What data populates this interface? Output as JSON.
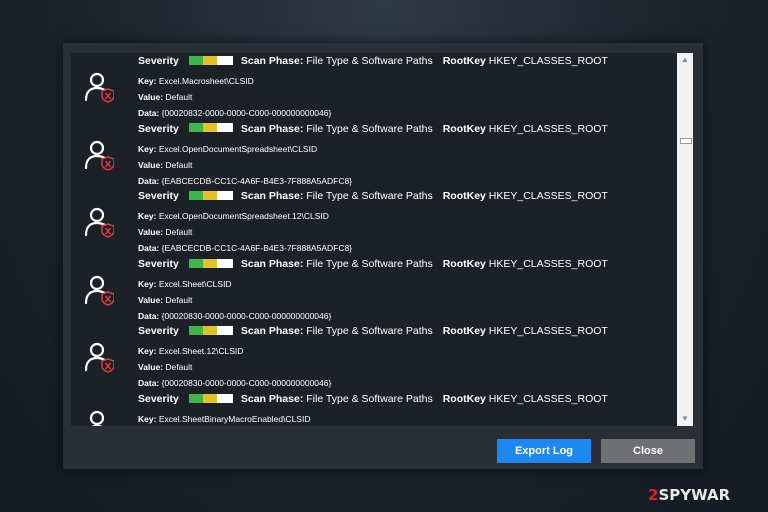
{
  "entries": [
    {
      "severity_label": "Severity",
      "phase_label": "Scan Phase:",
      "phase_value": "File Type & Software Paths",
      "rootkey_label": "RootKey",
      "rootkey_value": "HKEY_CLASSES_ROOT",
      "key_label": "Key:",
      "key_value": "Excel.Macrosheet\\CLSID",
      "value_label": "Value:",
      "value_value": "Default",
      "data_label": "Data:",
      "data_value": "{00020832-0000-0000-C000-000000000046}"
    },
    {
      "severity_label": "Severity",
      "phase_label": "Scan Phase:",
      "phase_value": "File Type & Software Paths",
      "rootkey_label": "RootKey",
      "rootkey_value": "HKEY_CLASSES_ROOT",
      "key_label": "Key:",
      "key_value": "Excel.OpenDocumentSpreadsheet\\CLSID",
      "value_label": "Value:",
      "value_value": "Default",
      "data_label": "Data:",
      "data_value": "{EABCECDB-CC1C-4A6F-B4E3-7F888A5ADFC8}"
    },
    {
      "severity_label": "Severity",
      "phase_label": "Scan Phase:",
      "phase_value": "File Type & Software Paths",
      "rootkey_label": "RootKey",
      "rootkey_value": "HKEY_CLASSES_ROOT",
      "key_label": "Key:",
      "key_value": "Excel.OpenDocumentSpreadsheet.12\\CLSID",
      "value_label": "Value:",
      "value_value": "Default",
      "data_label": "Data:",
      "data_value": "{EABCECDB-CC1C-4A6F-B4E3-7F888A5ADFC8}"
    },
    {
      "severity_label": "Severity",
      "phase_label": "Scan Phase:",
      "phase_value": "File Type & Software Paths",
      "rootkey_label": "RootKey",
      "rootkey_value": "HKEY_CLASSES_ROOT",
      "key_label": "Key:",
      "key_value": "Excel.Sheet\\CLSID",
      "value_label": "Value:",
      "value_value": "Default",
      "data_label": "Data:",
      "data_value": "{00020830-0000-0000-C000-000000000046}"
    },
    {
      "severity_label": "Severity",
      "phase_label": "Scan Phase:",
      "phase_value": "File Type & Software Paths",
      "rootkey_label": "RootKey",
      "rootkey_value": "HKEY_CLASSES_ROOT",
      "key_label": "Key:",
      "key_value": "Excel.Sheet.12\\CLSID",
      "value_label": "Value:",
      "value_value": "Default",
      "data_label": "Data:",
      "data_value": "{00020830-0000-0000-C000-000000000046}"
    },
    {
      "severity_label": "Severity",
      "phase_label": "Scan Phase:",
      "phase_value": "File Type & Software Paths",
      "rootkey_label": "RootKey",
      "rootkey_value": "HKEY_CLASSES_ROOT",
      "key_label": "Key:",
      "key_value": "Excel.SheetBinaryMacroEnabled\\CLSID",
      "value_label": "Value:",
      "value_value": "",
      "data_label": "Data:",
      "data_value": ""
    }
  ],
  "buttons": {
    "export_label": "Export Log",
    "close_label": "Close"
  },
  "watermark": {
    "prefix": "2",
    "brand": "SPYWAR"
  },
  "icons": {
    "entry_icon": "user-threat-icon"
  },
  "colors": {
    "severity_green": "#3fb54a",
    "severity_yellow": "#e3c12a",
    "export_button": "#1e87f0",
    "close_button": "#6d6f73"
  }
}
